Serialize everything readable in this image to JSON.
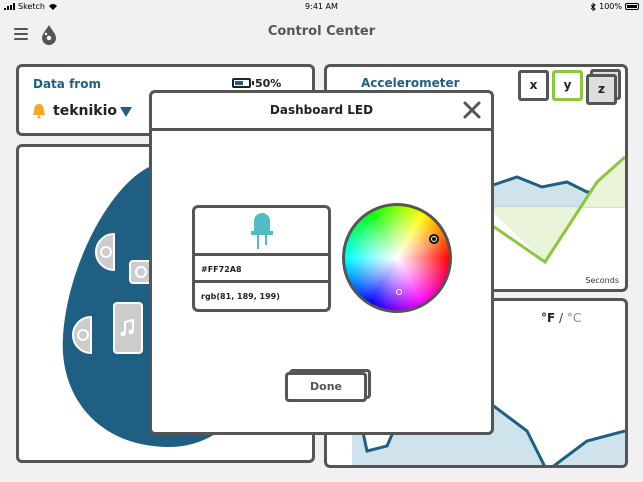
{
  "status_bar": {
    "carrier": "Sketch",
    "time": "9:41 AM",
    "battery": "100%"
  },
  "navbar": {
    "title": "Control Center"
  },
  "data_card": {
    "label": "Data from",
    "battery_percent": "50%",
    "device_name": "teknikio"
  },
  "accelerometer_card": {
    "title": "Accelerometer",
    "axes": [
      "x",
      "y",
      "z"
    ],
    "seconds_label": "Seconds"
  },
  "temperature_card": {
    "unit_f": "°F",
    "separator": " / ",
    "unit_c": "°C"
  },
  "modal": {
    "title": "Dashboard LED",
    "hex_value": "#FF72A8",
    "rgb_value": "rgb(81, 189, 199)",
    "done_label": "Done"
  },
  "colors": {
    "brand_blue": "#1f5f84",
    "led_teal": "#51bdc7",
    "accel_green": "#8cc63f",
    "border": "#555555"
  }
}
